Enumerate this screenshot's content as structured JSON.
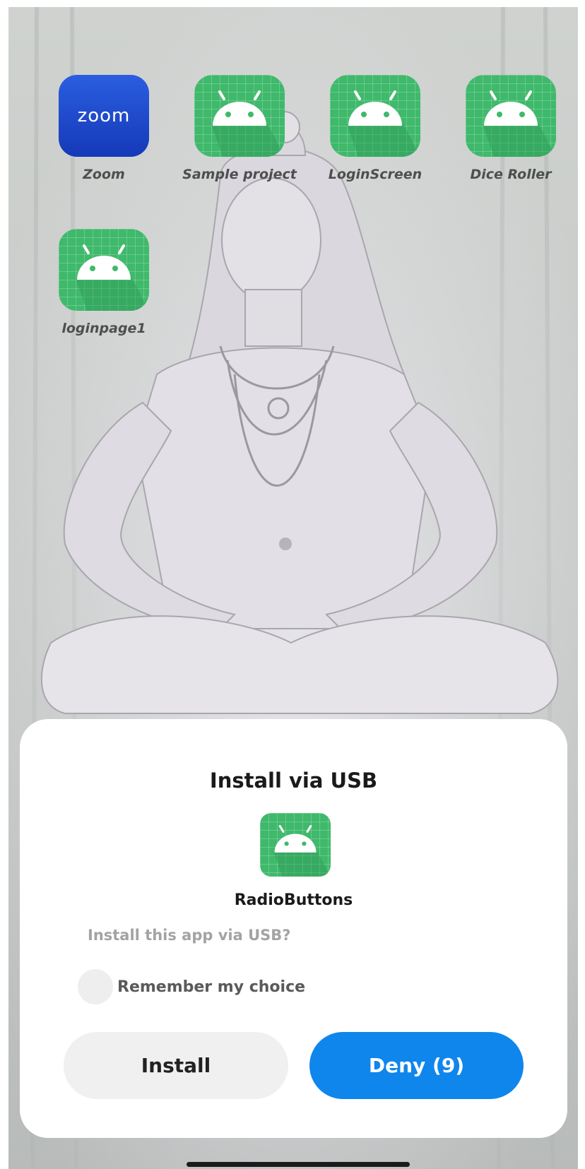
{
  "home_screen": {
    "apps": [
      {
        "label": "Zoom",
        "icon": "zoom-app-icon",
        "icon_text": "zoom"
      },
      {
        "label": "Sample project",
        "icon": "android-app-icon"
      },
      {
        "label": "LoginScreen",
        "icon": "android-app-icon"
      },
      {
        "label": "Dice Roller",
        "icon": "android-app-icon"
      },
      {
        "label": "loginpage1",
        "icon": "android-app-icon"
      }
    ]
  },
  "dialog": {
    "title": "Install via USB",
    "app_icon": "android-app-icon",
    "app_name": "RadioButtons",
    "question": "Install this app via USB?",
    "remember_label": "Remember my choice",
    "remember_checked": false,
    "install_label": "Install",
    "deny_label": "Deny (9)"
  },
  "colors": {
    "android_icon_bg": "#3fb96b",
    "zoom_icon_bg": "#1f4fd6",
    "deny_button_bg": "#0f86ec",
    "install_button_bg": "#f0f0f0"
  }
}
